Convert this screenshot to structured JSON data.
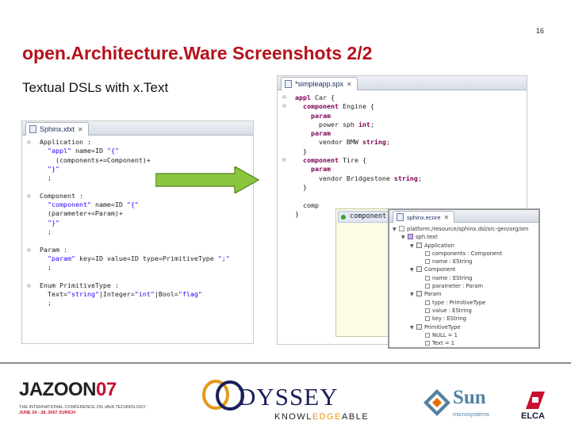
{
  "page_number": "16",
  "title": "open.Architecture.Ware Screenshots 2/2",
  "subtitle": "Textual DSLs with x.Text",
  "left_editor": {
    "tab_label": "Sphinx.xtxt",
    "lines": [
      "Application :",
      "  \"appl\" name=ID \"{\"",
      "    (components+=Component)+",
      "  \"}\"",
      "  ;",
      "",
      "Component :",
      "  \"component\" name=ID \"{\"",
      "  (parameter+=Param)+",
      "  \"}\"",
      "  ;",
      "",
      "Param :",
      "  \"param\" key=ID value=ID type=PrimitiveType \";\"",
      "  ;",
      "",
      "Enum PrimitiveType :",
      "  Text=\"string\"|Integer=\"int\"|Bool=\"flag\"",
      "  ;"
    ]
  },
  "right_editor": {
    "tab_label": "*simpleapp.spx",
    "lines": [
      "appl Car {",
      "  component Engine {",
      "    param",
      "      power sph int;",
      "    param",
      "      vendor BMW string;",
      "  }",
      "  component Tire {",
      "    param",
      "      vendor Bridgestone string;",
      "  }",
      "",
      "  comp",
      "}"
    ],
    "completion_item": "component"
  },
  "outline": {
    "tab_label": "sphinx.ecore",
    "rows": [
      {
        "text": "platform:/resource/sphinx.dsl/src-gen/org/om",
        "icon": "res",
        "level": 0
      },
      {
        "text": "sph.text",
        "icon": "root",
        "level": 1
      },
      {
        "text": "Application",
        "icon": "rule",
        "level": 2
      },
      {
        "text": "components : Component",
        "icon": "feat",
        "level": 3
      },
      {
        "text": "name : EString",
        "icon": "feat",
        "level": 3
      },
      {
        "text": "Component",
        "icon": "rule",
        "level": 2
      },
      {
        "text": "name : EString",
        "icon": "feat",
        "level": 3
      },
      {
        "text": "parameter : Param",
        "icon": "feat",
        "level": 3
      },
      {
        "text": "Param",
        "icon": "rule",
        "level": 2
      },
      {
        "text": "type : PrimitiveType",
        "icon": "feat",
        "level": 3
      },
      {
        "text": "value : EString",
        "icon": "feat",
        "level": 3
      },
      {
        "text": "key : EString",
        "icon": "feat",
        "level": 3
      },
      {
        "text": "PrimitiveType",
        "icon": "rule",
        "level": 2
      },
      {
        "text": "NULL = 1",
        "icon": "feat",
        "level": 3
      },
      {
        "text": "Text = 1",
        "icon": "feat",
        "level": 3
      }
    ]
  },
  "footer": {
    "jazoon_word_a": "JAZOON",
    "jazoon_word_b": "07",
    "jazoon_line1": "THE INTERNATIONAL CONFERENCE ON JAVA TECHNOLOGY",
    "jazoon_line2": "JUNE 24 - 28, 2007 ZURICH",
    "odyssey_word": "DYSSEY",
    "odyssey_sub_a": "KNOWL",
    "odyssey_sub_b": "EDGE",
    "odyssey_sub_c": "ABLE",
    "sun_word": "Sun",
    "sun_sub": "microsystems",
    "elca_word": "ELCA"
  },
  "colors": {
    "title": "#b5121b",
    "arrow_fill": "#8cc63f",
    "keyword": "#7f0055",
    "string": "#2a00ff"
  }
}
